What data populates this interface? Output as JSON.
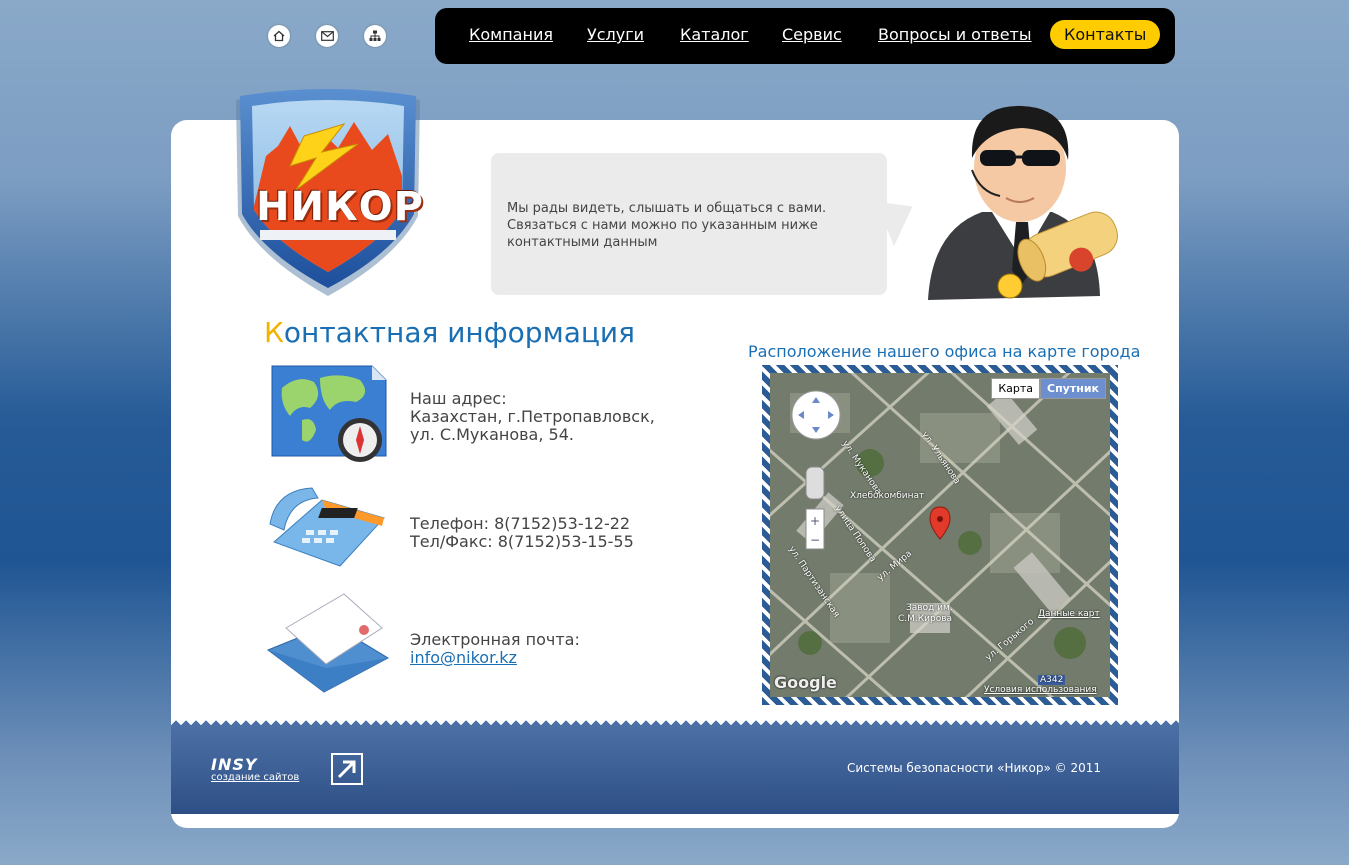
{
  "top_icons": [
    {
      "name": "home-icon"
    },
    {
      "name": "mail-icon"
    },
    {
      "name": "sitemap-icon"
    }
  ],
  "nav": {
    "items": [
      {
        "label": "Компания"
      },
      {
        "label": "Услуги"
      },
      {
        "label": "Каталог"
      },
      {
        "label": "Сервис"
      },
      {
        "label": "Вопросы и ответы"
      },
      {
        "label": "Контакты",
        "active": true
      }
    ]
  },
  "logo": {
    "text": "НИКОР"
  },
  "bubble": {
    "lines": [
      "Мы рады видеть, слышать и общаться с вами.",
      "Связаться с нами можно по указанным ниже",
      "контактными данным"
    ]
  },
  "contacts": {
    "title_first": "К",
    "title_rest": "онтактная информация",
    "address": {
      "label": "Наш адрес:",
      "line1": "Казахстан, г.Петропавловск,",
      "line2": "ул. С.Муканова, 54."
    },
    "phone": {
      "line1": "Телефон: 8(7152)53-12-22",
      "line2": "Тел/Факс: 8(7152)53-15-55"
    },
    "email": {
      "label": "Электронная почта:",
      "value": "info@nikor.kz"
    }
  },
  "map": {
    "title": "Расположение нашего офиса на карте города",
    "tab_map": "Карта",
    "tab_satellite": "Спутник",
    "labels": {
      "bakery": "Хлебокомбинат",
      "plant1": "Завод им.",
      "plant2": "С.М.Кирова",
      "road": "A342",
      "data": "Данные карт",
      "terms": "Условия использования",
      "google": "Google",
      "st_mukanova": "ул. Муканова",
      "st_ulyanova": "ул. Ульянова",
      "st_mira": "ул. Мира",
      "st_popova": "улица Попова",
      "st_partizanskaya": "ул. Партизанская",
      "st_gorkogo": "ул. Горького"
    }
  },
  "footer": {
    "insy_logo": "INSY",
    "insy_sub": "создание сайтов",
    "copyright": "Системы безопасности «Никор» © 2011"
  },
  "colors": {
    "accent": "#1a6fb4",
    "highlight": "#ffcc00",
    "nav_bg": "#000000",
    "footer": "#2d4f86"
  }
}
